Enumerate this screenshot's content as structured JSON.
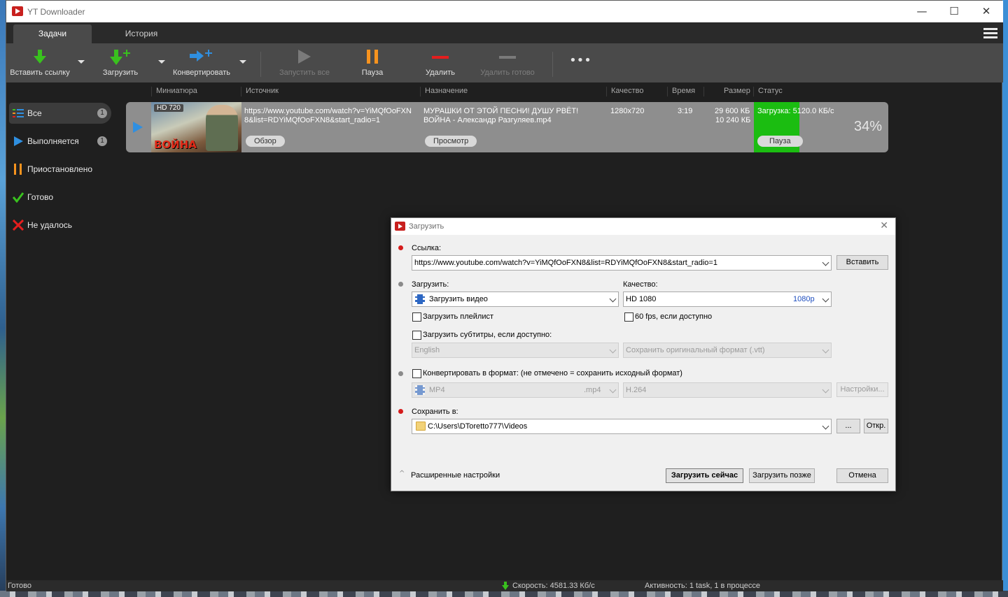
{
  "app": {
    "title": "YT Downloader"
  },
  "window_controls": {
    "minimize": "—",
    "maximize": "☐",
    "close": "✕"
  },
  "tabs": [
    "Задачи",
    "История"
  ],
  "toolbar": {
    "paste_link": "Вставить ссылку",
    "download": "Загрузить",
    "convert": "Конвертировать",
    "start_all": "Запустить все",
    "pause": "Пауза",
    "delete": "Удалить",
    "delete_done": "Удалить готово",
    "more": "•••"
  },
  "sidebar": {
    "items": [
      {
        "label": "Все",
        "count": "1"
      },
      {
        "label": "Выполняется",
        "count": "1"
      },
      {
        "label": "Приостановлено"
      },
      {
        "label": "Готово"
      },
      {
        "label": "Не удалось"
      }
    ]
  },
  "columns": [
    "Миниатюра",
    "Источник",
    "Назначение",
    "Качество",
    "Время",
    "Размер",
    "Статус"
  ],
  "task": {
    "thumb_badge": "HD 720",
    "thumb_text": "ВОЙНА",
    "source_line1": "https://www.youtube.com/watch?v=YiMQfOoFXN",
    "source_line2": "8&list=RDYiMQfOoFXN8&start_radio=1",
    "browse_btn": "Обзор",
    "dest_line1": "МУРАШКИ ОТ ЭТОЙ ПЕСНИ! ДУШУ РВЁТ!",
    "dest_line2": "ВОЙНА - Александр Разгуляев.mp4",
    "view_btn": "Просмотр",
    "quality": "1280x720",
    "time": "3:19",
    "size1": "29 600 КБ",
    "size2": "10 240 КБ",
    "status": "Загрузка: 5120.0 КБ/с",
    "pause_btn": "Пауза",
    "percent": "34%",
    "progress": 0.34
  },
  "statusbar": {
    "left": "Готово",
    "speed": "Скорость: 4581.33 Кб/с",
    "activity": "Активность: 1 task, 1 в процессе"
  },
  "dialog": {
    "title": "Загрузить",
    "link_label": "Ссылка:",
    "link_value": "https://www.youtube.com/watch?v=YiMQfOoFXN8&list=RDYiMQfOoFXN8&start_radio=1",
    "paste_btn": "Вставить",
    "download_label": "Загрузить:",
    "download_value": "Загрузить видео",
    "quality_label": "Качество:",
    "quality_value": "HD 1080",
    "quality_tag": "1080p",
    "playlist_check": "Загрузить плейлист",
    "fps_check": "60 fps, если доступно",
    "subs_check": "Загрузить субтитры, если доступно:",
    "subs_lang": "English",
    "subs_format": "Сохранить оригинальный формат (.vtt)",
    "convert_check": "Конвертировать в формат: (не отмечено = сохранить исходный формат)",
    "convert_format": "MP4",
    "convert_ext": ".mp4",
    "convert_codec": "H.264",
    "settings_btn": "Настройки...",
    "save_label": "Сохранить в:",
    "save_path": "C:\\Users\\DToretto777\\Videos",
    "browse_btn": "...",
    "open_btn": "Откр.",
    "advanced": "Расширенные настройки",
    "download_now": "Загрузить сейчас",
    "download_later": "Загрузить позже",
    "cancel": "Отмена"
  }
}
